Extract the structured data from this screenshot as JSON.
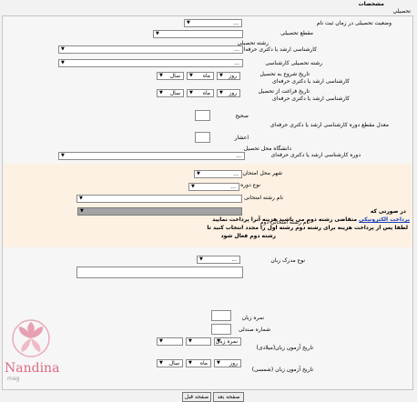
{
  "section": {
    "title": "مشخصات",
    "subtitle": "تحصیلی"
  },
  "form": {
    "status_label": "وضعیت تحصیلی در زمان ثبت نام",
    "status_value": "...",
    "grade_label": "مقطع تحصیلی",
    "major_label": "رشته تحصیلی",
    "major_sub_label": "کارشناسی ارشد یا دکتری حرفه‌ای",
    "major_value": "...",
    "bachelor_major_label": "رشته تحصیلی کارشناسی",
    "bachelor_major_value": "...",
    "start_date_label": "تاریخ شروع به تحصیل",
    "start_date_sub_label": "کارشناسی ارشد یا دکتری حرفه‌ای",
    "end_date_label": "تاریخ فراغت از تحصیل",
    "end_date_sub_label": "کارشناسی ارشد یا دکتری حرفه‌ای",
    "date_day": "روز",
    "date_month": "ماه",
    "date_year": "سال",
    "gpa_label": "معدل مقطع دوره کارشناسی ارشد یا دکتری حرفه‌ای",
    "gpa_int_label": "صحیح",
    "gpa_dec_label": "اعشار",
    "university_label": "دانشگاه محل تحصیل",
    "university_sub_label": "دوره کارشناسی ارشد یا دکتری حرفه‌ای",
    "university_value": "..."
  },
  "exam": {
    "city_label": "شهر محل امتحان",
    "city_value": "...",
    "course_type_label": "نوع دوره",
    "course_type_value": "...",
    "major1_label": "نام رشته امتحانی اول",
    "major2_label": "نام رشته امتحانی دوم",
    "notice_line1": "در صورتی که",
    "notice_line2_pre": "متقاضی رشته دوم می باشید هزینه آنرا پرداخت نمایید",
    "notice_link": "پرداخت الکترونیکی",
    "notice_line3": "لطفا پس از پرداخت هزینه برای رشته دوم رشته اول را مجدد انتخاب کنید تا",
    "notice_line4": "رشته دوم فعال شود"
  },
  "language": {
    "cert_type_label": "نوع مدرک زبان",
    "cert_type_value": "...",
    "score_label": "نمره زبان",
    "seat_number_label": "شماره صندلی",
    "exam_date_gregorian_label": "تاریخ آزمون زبان(میلادی)",
    "exam_date_solar_label": "تاریخ آزمون زبان (شمسی)"
  },
  "nav": {
    "next_label": "صفحه بعد",
    "prev_label": "صفحه قبل"
  },
  "watermark": {
    "brand": "Nandina",
    "sub": "mag"
  },
  "colors": {
    "band": "#fcf1e3",
    "selected_gray": "#a4a4a4",
    "link": "#1a3fb5",
    "brand": "#d96b86"
  }
}
